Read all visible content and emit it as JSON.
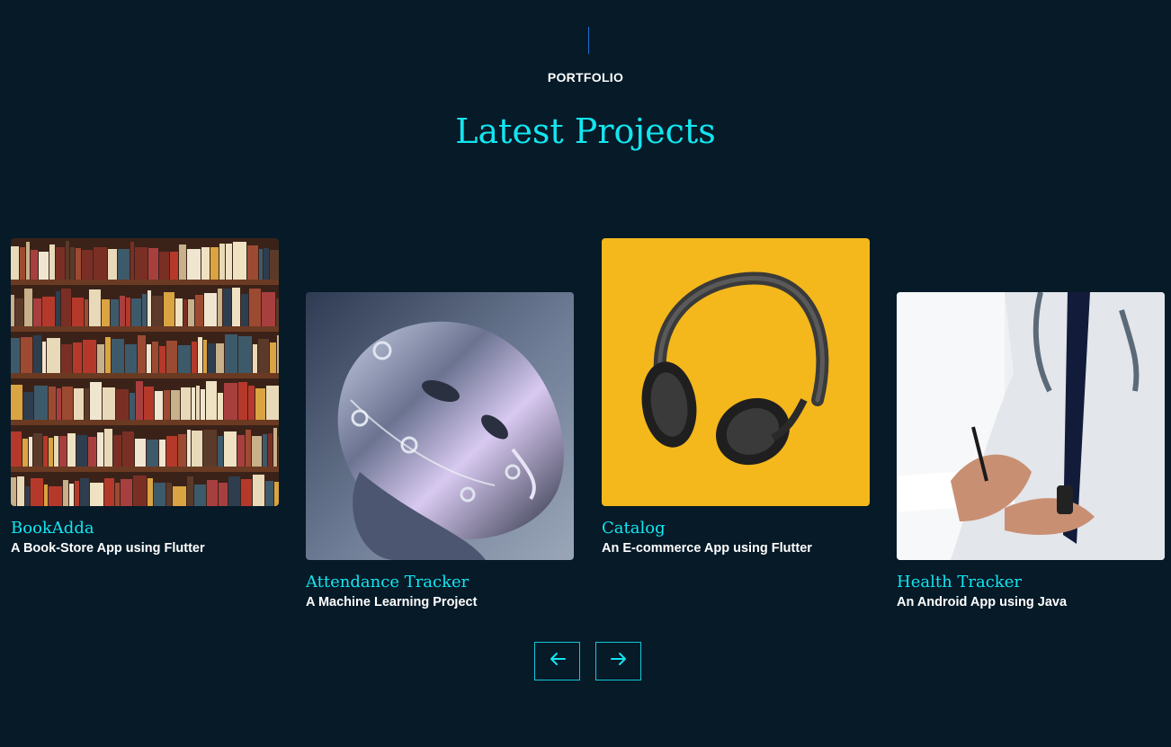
{
  "section": {
    "eyebrow": "PORTFOLIO",
    "title": "Latest Projects"
  },
  "projects": [
    {
      "title": "BookAdda",
      "subtitle": "A Book-Store App using Flutter",
      "image": "bookshelf-photo"
    },
    {
      "title": "Attendance Tracker",
      "subtitle": "A Machine Learning Project",
      "image": "chrome-robot-head-photo"
    },
    {
      "title": "Catalog",
      "subtitle": "An E-commerce App using Flutter",
      "image": "headphones-photo"
    },
    {
      "title": "Health Tracker",
      "subtitle": "An Android App using Java",
      "image": "doctor-writing-photo"
    }
  ],
  "controls": {
    "prev_icon": "arrow-left-icon",
    "next_icon": "arrow-right-icon"
  },
  "colors": {
    "background": "#061a28",
    "accent": "#12e6f0",
    "text": "#ffffff"
  }
}
